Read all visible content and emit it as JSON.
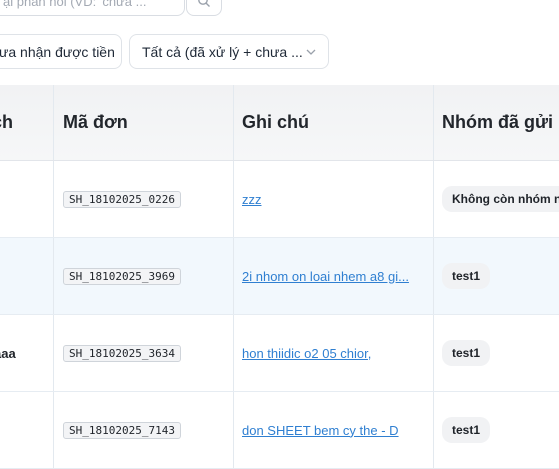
{
  "search": {
    "placeholder": "ại phản hồi (VD: 'chưa ...",
    "button_icon": "search-icon"
  },
  "filters": {
    "payment_label": "ưa nhận được tiền",
    "status_label": "Tất cả (đã xử lý + chưa ...",
    "status_chevron": "chevron-down-icon"
  },
  "table": {
    "headers": [
      "ch",
      "Mã đơn",
      "Ghi chú",
      "Nhóm đã gửi"
    ],
    "rows": [
      {
        "col1": "",
        "order": "SH_18102025_0226",
        "note": "zzz",
        "group": "Không còn nhóm n"
      },
      {
        "col1": "",
        "order": "SH_18102025_3969",
        "note": "2i nhom on loai nhem a8 gi...",
        "group": "test1"
      },
      {
        "col1": "aaa",
        "order": "SH_18102025_3634",
        "note": "hon thiidic o2 05 chior,",
        "group": "test1"
      },
      {
        "col1": "",
        "order": "SH_18102025_7143",
        "note": "don SHEET bem cy the - D",
        "group": "test1"
      }
    ]
  }
}
